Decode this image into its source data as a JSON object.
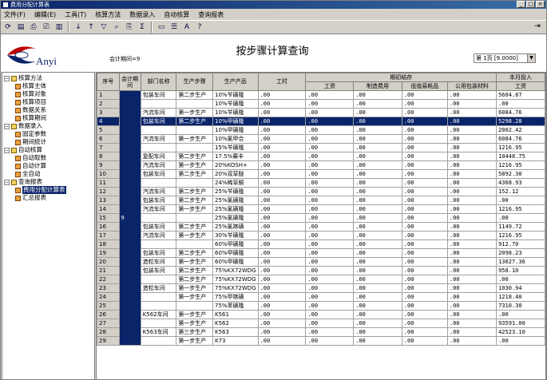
{
  "window": {
    "title": "费用分配计算表"
  },
  "menu": [
    "文件(F)",
    "编辑(E)",
    "工具(T)",
    "核算方法",
    "数据录入",
    "自动核算",
    "查询报表"
  ],
  "header": {
    "logo_text": "Anyi",
    "period_count": "会计期间=9",
    "page_title": "按步骤计算查询",
    "page_select": "第 1页 [9.0000]"
  },
  "tree": [
    {
      "label": "核算方法",
      "level": 0,
      "type": "folder"
    },
    {
      "label": "核算主体",
      "level": 1,
      "type": "leaf"
    },
    {
      "label": "核算对象",
      "level": 1,
      "type": "leaf"
    },
    {
      "label": "核算项目",
      "level": 1,
      "type": "leaf"
    },
    {
      "label": "数据关系",
      "level": 1,
      "type": "leaf"
    },
    {
      "label": "核算期间",
      "level": 1,
      "type": "leaf"
    },
    {
      "label": "数据录入",
      "level": 0,
      "type": "folder"
    },
    {
      "label": "固定参数",
      "level": 1,
      "type": "leaf"
    },
    {
      "label": "期间统计",
      "level": 1,
      "type": "leaf"
    },
    {
      "label": "自动核算",
      "level": 0,
      "type": "folder"
    },
    {
      "label": "自动取数",
      "level": 1,
      "type": "leaf"
    },
    {
      "label": "自动计算",
      "level": 1,
      "type": "leaf"
    },
    {
      "label": "全自动",
      "level": 1,
      "type": "leaf"
    },
    {
      "label": "查询报表",
      "level": 0,
      "type": "folder"
    },
    {
      "label": "费用分配计算表",
      "level": 1,
      "type": "leaf",
      "selected": true
    },
    {
      "label": "汇总报表",
      "level": 1,
      "type": "leaf"
    }
  ],
  "columns": {
    "seq": "序号",
    "period": "会计期间",
    "dept": "部门名称",
    "step": "生产步骤",
    "product": "生产产品",
    "hours": "工时",
    "opening": "期初结存",
    "wage": "工资",
    "mfg": "制造费用",
    "consumables": "低值易耗品",
    "packaging": "公用包装材料",
    "current": "本月投入",
    "cur_wage": "工资"
  },
  "period_value": "9",
  "rows": [
    {
      "n": "1",
      "dept": "包装车间",
      "step": "第二步生产",
      "prod": "10%苄磺隆",
      "h": ".00",
      "w": ".00",
      "m": ".00",
      "c": ".00",
      "p": ".00",
      "cw": "5604.87"
    },
    {
      "n": "2",
      "dept": "",
      "step": "",
      "prod": "10%苄磺隆",
      "h": ".00",
      "w": ".00",
      "m": ".00",
      "c": ".00",
      "p": ".00",
      "cw": ".00"
    },
    {
      "n": "3",
      "dept": "汽流车间",
      "step": "第一步生产",
      "prod": "10%苄磺隆",
      "h": ".00",
      "w": ".00",
      "m": ".00",
      "c": ".00",
      "p": ".00",
      "cw": "6084.76"
    },
    {
      "n": "4",
      "dept": "包装车间",
      "step": "第二步生产",
      "prod": "10%甲磺隆",
      "h": ".00",
      "w": ".00",
      "m": ".00",
      "c": ".00",
      "p": ".00",
      "cw": "5298.28",
      "sel": true
    },
    {
      "n": "5",
      "dept": "",
      "step": "",
      "prod": "10%甲磺隆",
      "h": ".00",
      "w": ".00",
      "m": ".00",
      "c": ".00",
      "p": ".00",
      "cw": "2002.42"
    },
    {
      "n": "6",
      "dept": "汽流车间",
      "step": "第一步生产",
      "prod": "10%氯甲合",
      "h": ".00",
      "w": ".00",
      "m": ".00",
      "c": ".00",
      "p": ".00",
      "cw": "6084.76"
    },
    {
      "n": "7",
      "dept": "",
      "step": "",
      "prod": "15%苄磺隆",
      "h": ".00",
      "w": ".00",
      "m": ".00",
      "c": ".00",
      "p": ".00",
      "cw": "1216.95"
    },
    {
      "n": "8",
      "dept": "复配车间",
      "step": "第二步生产",
      "prod": "17.5%粟丰",
      "h": ".00",
      "w": ".00",
      "m": ".00",
      "c": ".00",
      "p": ".00",
      "cw": "10448.75"
    },
    {
      "n": "9",
      "dept": "汽流车间",
      "step": "第一步生产",
      "prod": "20%KOSH+",
      "h": ".00",
      "w": ".00",
      "m": ".00",
      "c": ".00",
      "p": ".00",
      "cw": "1216.95"
    },
    {
      "n": "10",
      "dept": "包装车间",
      "step": "第二步生产",
      "prod": "20%双草醚",
      "h": ".00",
      "w": ".00",
      "m": ".00",
      "c": ".00",
      "p": ".00",
      "cw": "5892.30"
    },
    {
      "n": "11",
      "dept": "",
      "step": "",
      "prod": "24%稀草酮",
      "h": ".00",
      "w": ".00",
      "m": ".00",
      "c": ".00",
      "p": ".00",
      "cw": "4368.93"
    },
    {
      "n": "12",
      "dept": "汽流车间",
      "step": "第二步生产",
      "prod": "25%苄磺隆",
      "h": ".00",
      "w": ".00",
      "m": ".00",
      "c": ".00",
      "p": ".00",
      "cw": "152.12"
    },
    {
      "n": "13",
      "dept": "包装车间",
      "step": "第二步生产",
      "prod": "25%氯磺隆",
      "h": ".00",
      "w": ".00",
      "m": ".00",
      "c": ".00",
      "p": ".00",
      "cw": ".00"
    },
    {
      "n": "14",
      "dept": "汽流车间",
      "step": "第一步生产",
      "prod": "25%氯磺隆",
      "h": ".00",
      "w": ".00",
      "m": ".00",
      "c": ".00",
      "p": ".00",
      "cw": "1216.95"
    },
    {
      "n": "15",
      "dept": "",
      "step": "",
      "prod": "25%氯磺隆",
      "h": ".00",
      "w": ".00",
      "m": ".00",
      "c": ".00",
      "p": ".00",
      "cw": ".00"
    },
    {
      "n": "16",
      "dept": "包装车间",
      "step": "第二步生产",
      "prod": "25%氯喀磺",
      "h": ".00",
      "w": ".00",
      "m": ".00",
      "c": ".00",
      "p": ".00",
      "cw": "1149.72"
    },
    {
      "n": "17",
      "dept": "汽流车间",
      "step": "第一步生产",
      "prod": "30%苄磺隆",
      "h": ".00",
      "w": ".00",
      "m": ".00",
      "c": ".00",
      "p": ".00",
      "cw": "1216.95"
    },
    {
      "n": "18",
      "dept": "",
      "step": "",
      "prod": "60%甲磺隆",
      "h": ".00",
      "w": ".00",
      "m": ".00",
      "c": ".00",
      "p": ".00",
      "cw": "912.70"
    },
    {
      "n": "19",
      "dept": "包装车间",
      "step": "第二步生产",
      "prod": "60%甲磺隆",
      "h": ".00",
      "w": ".00",
      "m": ".00",
      "c": ".00",
      "p": ".00",
      "cw": "2098.23"
    },
    {
      "n": "20",
      "dept": "造粒车间",
      "step": "第一步生产",
      "prod": "60%甲磺隆",
      "h": ".00",
      "w": ".00",
      "m": ".00",
      "c": ".00",
      "p": ".00",
      "cw": "13027.36"
    },
    {
      "n": "21",
      "dept": "包装车间",
      "step": "第二步生产",
      "prod": "75%KX72WDG",
      "h": ".00",
      "w": ".00",
      "m": ".00",
      "c": ".00",
      "p": ".00",
      "cw": "958.10"
    },
    {
      "n": "22",
      "dept": "",
      "step": "第二步生产",
      "prod": "75%KX72WDG",
      "h": ".00",
      "w": ".00",
      "m": ".00",
      "c": ".00",
      "p": ".00",
      "cw": ".00"
    },
    {
      "n": "23",
      "dept": "造粒车间",
      "step": "第一步生产",
      "prod": "75%KX72WDG",
      "h": ".00",
      "w": ".00",
      "m": ".00",
      "c": ".00",
      "p": ".00",
      "cw": "1030.94"
    },
    {
      "n": "24",
      "dept": "",
      "step": "第一步生产",
      "prod": "75%甲喀磺",
      "h": ".00",
      "w": ".00",
      "m": ".00",
      "c": ".00",
      "p": ".00",
      "cw": "1218.40"
    },
    {
      "n": "25",
      "dept": "",
      "step": "",
      "prod": "75%苯磺隆",
      "h": ".00",
      "w": ".00",
      "m": ".00",
      "c": ".00",
      "p": ".00",
      "cw": "7310.30"
    },
    {
      "n": "26",
      "dept": "K562车间",
      "step": "第一步生产",
      "prod": "K561",
      "h": ".00",
      "w": ".00",
      "m": ".00",
      "c": ".00",
      "p": ".00",
      "cw": ".00"
    },
    {
      "n": "27",
      "dept": "",
      "step": "第一步生产",
      "prod": "K562",
      "h": ".00",
      "w": ".00",
      "m": ".00",
      "c": ".00",
      "p": ".00",
      "cw": "93591.00"
    },
    {
      "n": "28",
      "dept": "K563车间",
      "step": "第三步生产",
      "prod": "K563",
      "h": ".00",
      "w": ".00",
      "m": ".00",
      "c": ".00",
      "p": ".00",
      "cw": "42523.10"
    },
    {
      "n": "29",
      "dept": "",
      "step": "第一步生产",
      "prod": "K73",
      "h": ".00",
      "w": ".00",
      "m": ".00",
      "c": ".00",
      "p": ".00",
      "cw": ".00"
    }
  ]
}
